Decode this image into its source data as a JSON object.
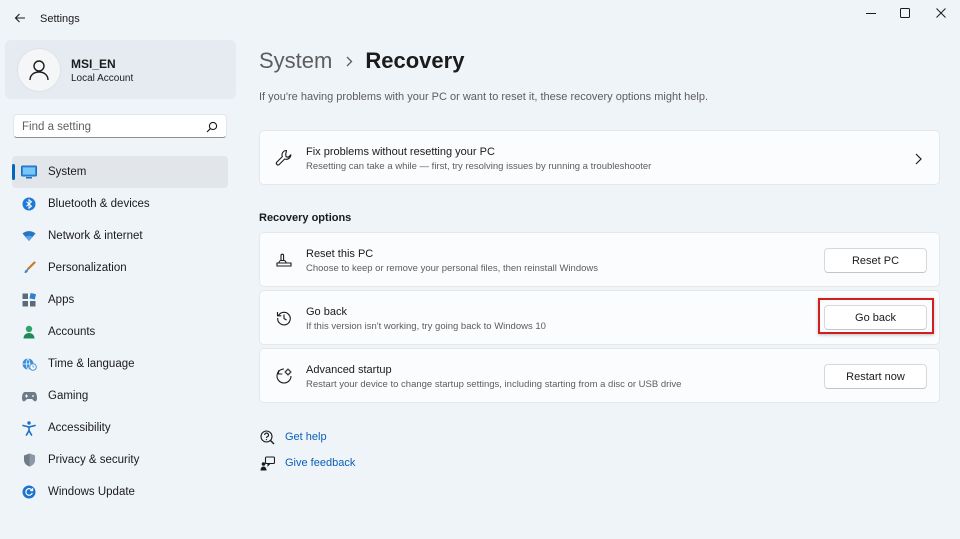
{
  "window": {
    "title": "Settings"
  },
  "user": {
    "name": "MSI_EN",
    "account_type": "Local Account"
  },
  "search": {
    "placeholder": "Find a setting"
  },
  "sidebar": {
    "items": [
      {
        "label": "System",
        "icon": "system-icon",
        "selected": true
      },
      {
        "label": "Bluetooth & devices",
        "icon": "bluetooth-icon"
      },
      {
        "label": "Network & internet",
        "icon": "wifi-icon"
      },
      {
        "label": "Personalization",
        "icon": "brush-icon"
      },
      {
        "label": "Apps",
        "icon": "apps-icon"
      },
      {
        "label": "Accounts",
        "icon": "person-icon"
      },
      {
        "label": "Time & language",
        "icon": "globe-clock-icon"
      },
      {
        "label": "Gaming",
        "icon": "gamepad-icon"
      },
      {
        "label": "Accessibility",
        "icon": "accessibility-icon"
      },
      {
        "label": "Privacy & security",
        "icon": "shield-icon"
      },
      {
        "label": "Windows Update",
        "icon": "update-icon"
      }
    ]
  },
  "breadcrumb": {
    "parent": "System",
    "current": "Recovery"
  },
  "intro_text": "If you're having problems with your PC or want to reset it, these recovery options might help.",
  "fix_card": {
    "title": "Fix problems without resetting your PC",
    "description": "Resetting can take a while — first, try resolving issues by running a troubleshooter"
  },
  "recovery_section": {
    "heading": "Recovery options",
    "items": [
      {
        "title": "Reset this PC",
        "description": "Choose to keep or remove your personal files, then reinstall Windows",
        "button": "Reset PC"
      },
      {
        "title": "Go back",
        "description": "If this version isn't working, try going back to Windows 10",
        "button": "Go back"
      },
      {
        "title": "Advanced startup",
        "description": "Restart your device to change startup settings, including starting from a disc or USB drive",
        "button": "Restart now"
      }
    ]
  },
  "links": {
    "help": "Get help",
    "feedback": "Give feedback"
  },
  "colors": {
    "accent": "#0067c0",
    "link": "#0a5fb4",
    "highlight": "#d11e1e"
  }
}
